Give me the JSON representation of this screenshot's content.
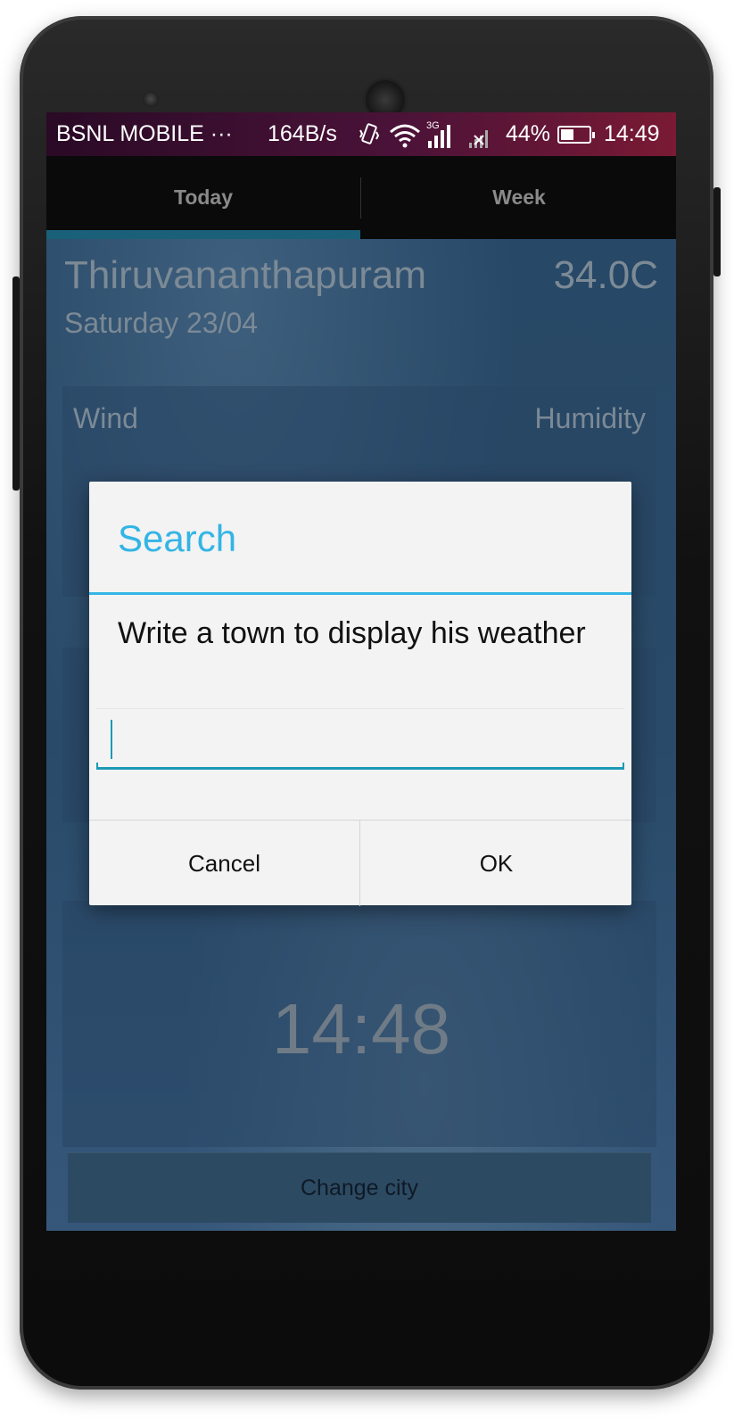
{
  "status_bar": {
    "carrier": "BSNL MOBILE ···",
    "speed": "164B/s",
    "network_type": "3G",
    "battery": "44%",
    "time": "14:49",
    "icons": [
      "vibrate-icon",
      "wifi-icon",
      "signal-icon",
      "no-signal-icon",
      "battery-icon"
    ]
  },
  "tabs": [
    {
      "label": "Today",
      "selected": true
    },
    {
      "label": "Week",
      "selected": false
    }
  ],
  "weather": {
    "city": "Thiruvananthapuram",
    "temperature": "34.0C",
    "date": "Saturday 23/04",
    "wind_label": "Wind",
    "humidity_label": "Humidity",
    "clock": "14:48"
  },
  "change_city_label": "Change city",
  "dialog": {
    "title": "Search",
    "message": "Write a town to display his weather",
    "input_value": "",
    "cancel_label": "Cancel",
    "ok_label": "OK"
  },
  "colors": {
    "accent": "#33b5e5",
    "input_accent": "#1d9ab5",
    "status_bar": "#4a1238"
  }
}
